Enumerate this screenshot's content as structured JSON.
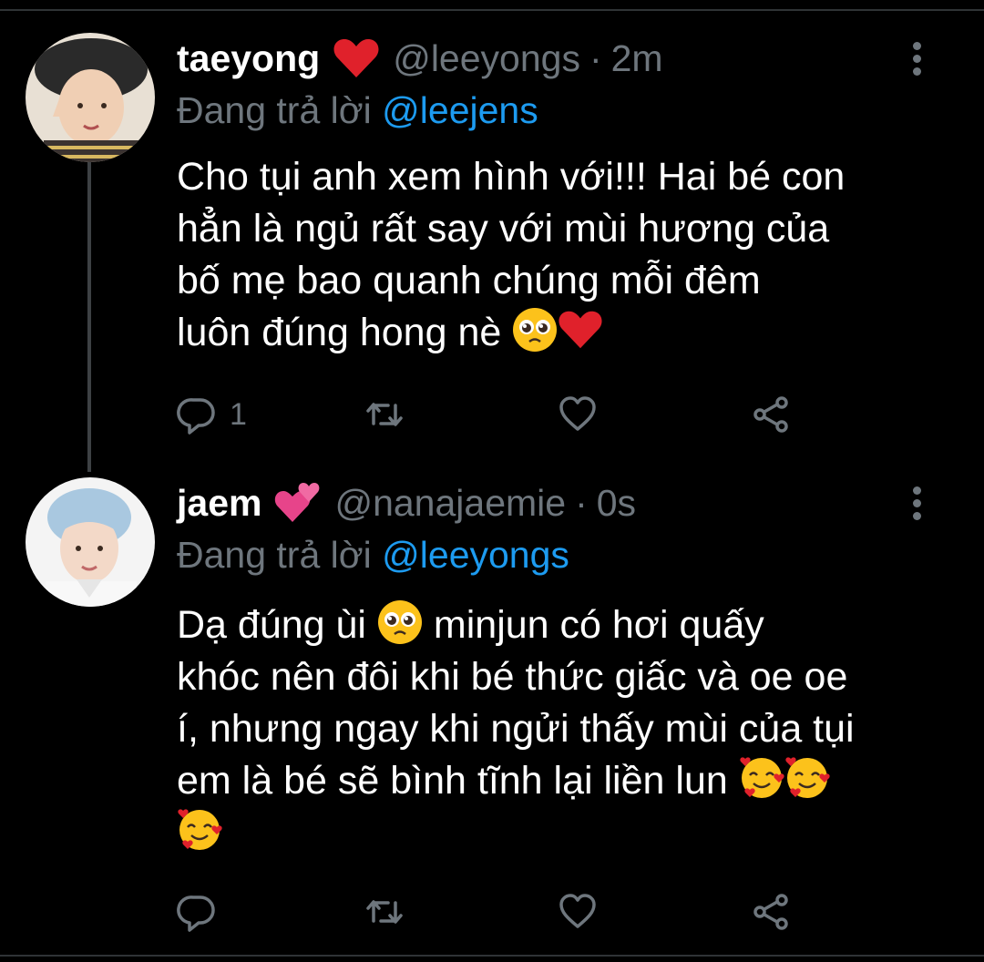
{
  "tweets": [
    {
      "name": "taeyong",
      "name_emoji": "heart",
      "handle": "@leeyongs",
      "time": "2m",
      "separator": "·",
      "replying_prefix": "Đang trả lời",
      "replying_to": "@leejens",
      "body_lines": [
        "Cho tụi anh xem hình với!!! Hai bé con",
        "hẳn là ngủ rất say với mùi hương của",
        "bố mẹ bao quanh chúng mỗi đêm",
        "luôn đúng hong nè"
      ],
      "body_emojis": [
        "pleading-face",
        "red-heart"
      ],
      "reply_count": "1",
      "avatar_color": "#c9a27e"
    },
    {
      "name": "jaem",
      "name_emoji": "two-hearts",
      "handle": "@nanajaemie",
      "time": "0s",
      "separator": "·",
      "replying_prefix": "Đang trả lời",
      "replying_to": "@leeyongs",
      "body_lines": [
        "Dạ đúng ùi",
        "minjun có hơi quấy",
        "khóc nên đôi khi bé thức giấc và oe oe",
        "í, nhưng ngay khi ngửi thấy mùi của tụi",
        "em là bé sẽ bình tĩnh lại liền lun"
      ],
      "body_emojis": [
        "pleading-face",
        "smiling-face-with-hearts",
        "smiling-face-with-hearts",
        "smiling-face-with-hearts"
      ],
      "reply_count": "",
      "avatar_color": "#a9c8e0"
    }
  ],
  "colors": {
    "background": "#000000",
    "secondary_text": "#6e767d",
    "mention": "#1d9bf0",
    "divider": "#2f3336"
  },
  "icons": [
    "reply-icon",
    "retweet-icon",
    "like-icon",
    "share-icon",
    "more-icon"
  ]
}
